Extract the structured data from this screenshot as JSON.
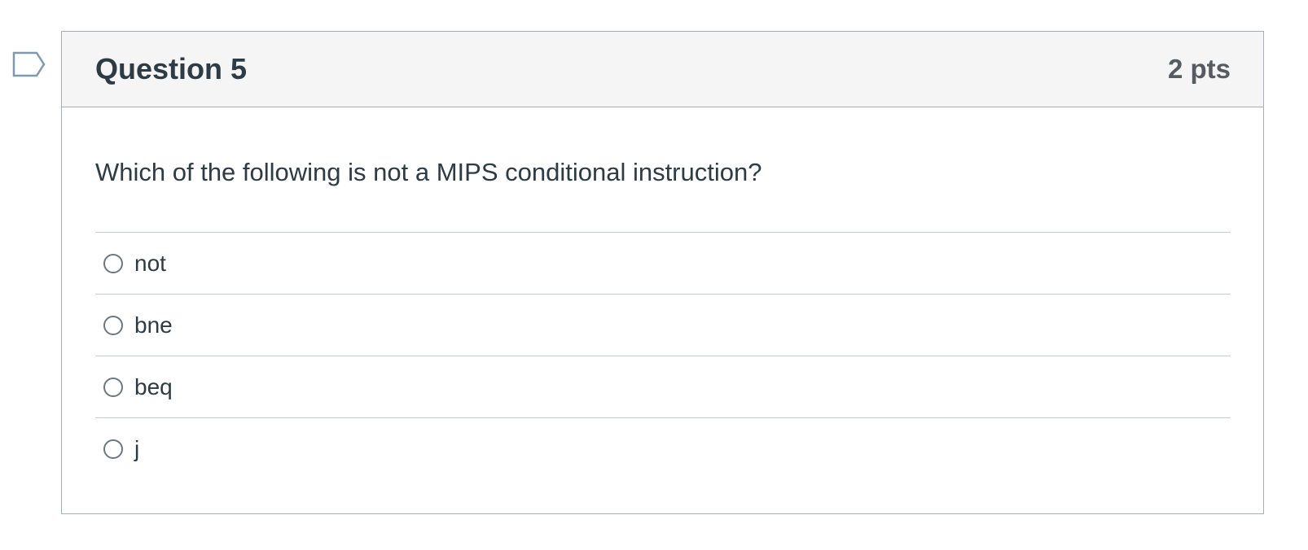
{
  "question": {
    "title": "Question 5",
    "points": "2 pts",
    "text": "Which of the following is not a MIPS conditional instruction?",
    "flag_icon": "bookmark-flag-icon",
    "answers": [
      {
        "label": "not",
        "selected": false
      },
      {
        "label": "bne",
        "selected": false
      },
      {
        "label": "beq",
        "selected": false
      },
      {
        "label": "j",
        "selected": false
      }
    ]
  },
  "colors": {
    "header_bg": "#f5f5f5",
    "border": "#a5afb5",
    "text": "#2d3b45",
    "flag": "#7f9ab0"
  }
}
